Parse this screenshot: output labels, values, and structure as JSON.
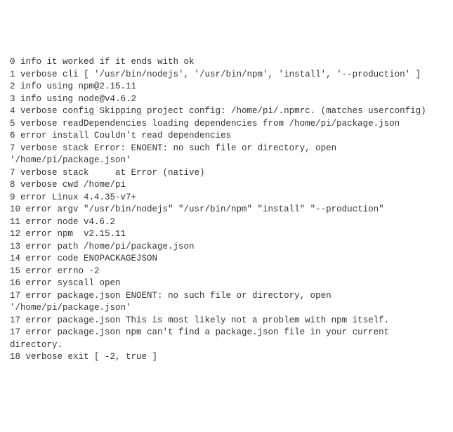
{
  "log": {
    "lines": [
      "0 info it worked if it ends with ok",
      "1 verbose cli [ '/usr/bin/nodejs', '/usr/bin/npm', 'install', '--production' ]",
      "2 info using npm@2.15.11",
      "3 info using node@v4.6.2",
      "4 verbose config Skipping project config: /home/pi/.npmrc. (matches userconfig)",
      "5 verbose readDependencies loading dependencies from /home/pi/package.json",
      "6 error install Couldn't read dependencies",
      "7 verbose stack Error: ENOENT: no such file or directory, open '/home/pi/package.json'",
      "7 verbose stack     at Error (native)",
      "8 verbose cwd /home/pi",
      "9 error Linux 4.4.35-v7+",
      "10 error argv \"/usr/bin/nodejs\" \"/usr/bin/npm\" \"install\" \"--production\"",
      "11 error node v4.6.2",
      "12 error npm  v2.15.11",
      "13 error path /home/pi/package.json",
      "14 error code ENOPACKAGEJSON",
      "15 error errno -2",
      "16 error syscall open",
      "17 error package.json ENOENT: no such file or directory, open '/home/pi/package.json'",
      "17 error package.json This is most likely not a problem with npm itself.",
      "17 error package.json npm can't find a package.json file in your current directory.",
      "18 verbose exit [ -2, true ]"
    ]
  }
}
